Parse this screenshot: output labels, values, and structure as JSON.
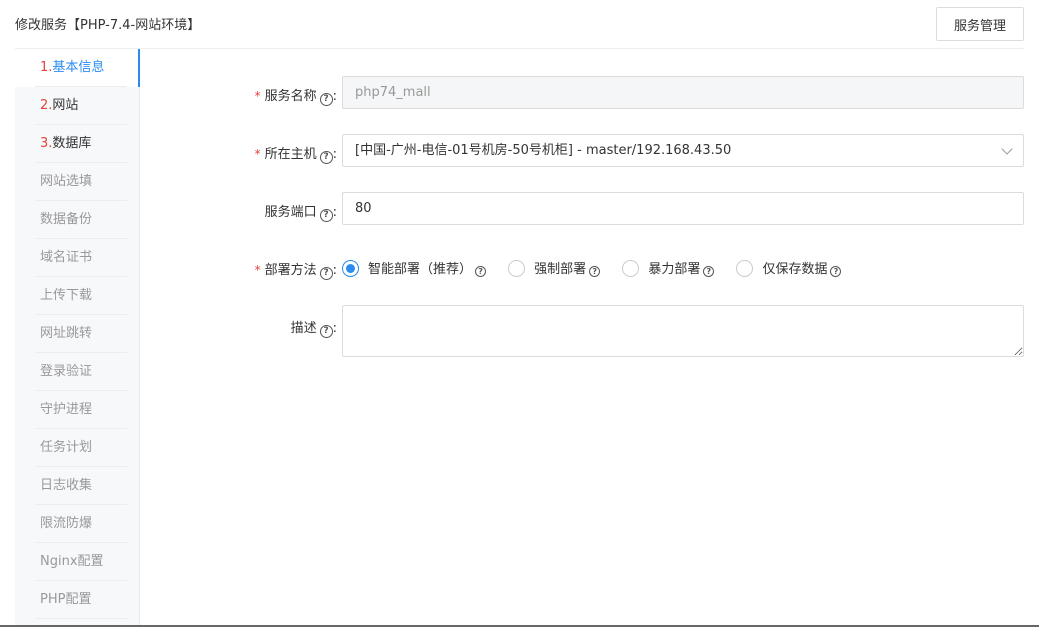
{
  "header": {
    "title": "修改服务【PHP-7.4-网站环境】",
    "manage_button": "服务管理"
  },
  "sidebar": {
    "items": [
      {
        "num": "1.",
        "label": "基本信息"
      },
      {
        "num": "2.",
        "label": "网站"
      },
      {
        "num": "3.",
        "label": "数据库"
      },
      {
        "num": "",
        "label": "网站选填"
      },
      {
        "num": "",
        "label": "数据备份"
      },
      {
        "num": "",
        "label": "域名证书"
      },
      {
        "num": "",
        "label": "上传下载"
      },
      {
        "num": "",
        "label": "网址跳转"
      },
      {
        "num": "",
        "label": "登录验证"
      },
      {
        "num": "",
        "label": "守护进程"
      },
      {
        "num": "",
        "label": "任务计划"
      },
      {
        "num": "",
        "label": "日志收集"
      },
      {
        "num": "",
        "label": "限流防爆"
      },
      {
        "num": "",
        "label": "Nginx配置"
      },
      {
        "num": "",
        "label": "PHP配置"
      }
    ]
  },
  "form": {
    "required_mark": "*",
    "help_glyph": "?",
    "colon": ":",
    "service_name": {
      "label": "服务名称",
      "value": "php74_mall"
    },
    "host": {
      "label": "所在主机",
      "value": "[中国-广州-电信-01号机房-50号机柜] - master/192.168.43.50"
    },
    "port": {
      "label": "服务端口",
      "value": "80"
    },
    "deploy": {
      "label": "部署方法",
      "options": [
        {
          "label": "智能部署（推荐）",
          "checked": true
        },
        {
          "label": "强制部署",
          "checked": false
        },
        {
          "label": "暴力部署",
          "checked": false
        },
        {
          "label": "仅保存数据",
          "checked": false
        }
      ]
    },
    "description": {
      "label": "描述",
      "value": ""
    }
  },
  "colors": {
    "accent": "#2b8cf0",
    "required": "#e4433b"
  }
}
